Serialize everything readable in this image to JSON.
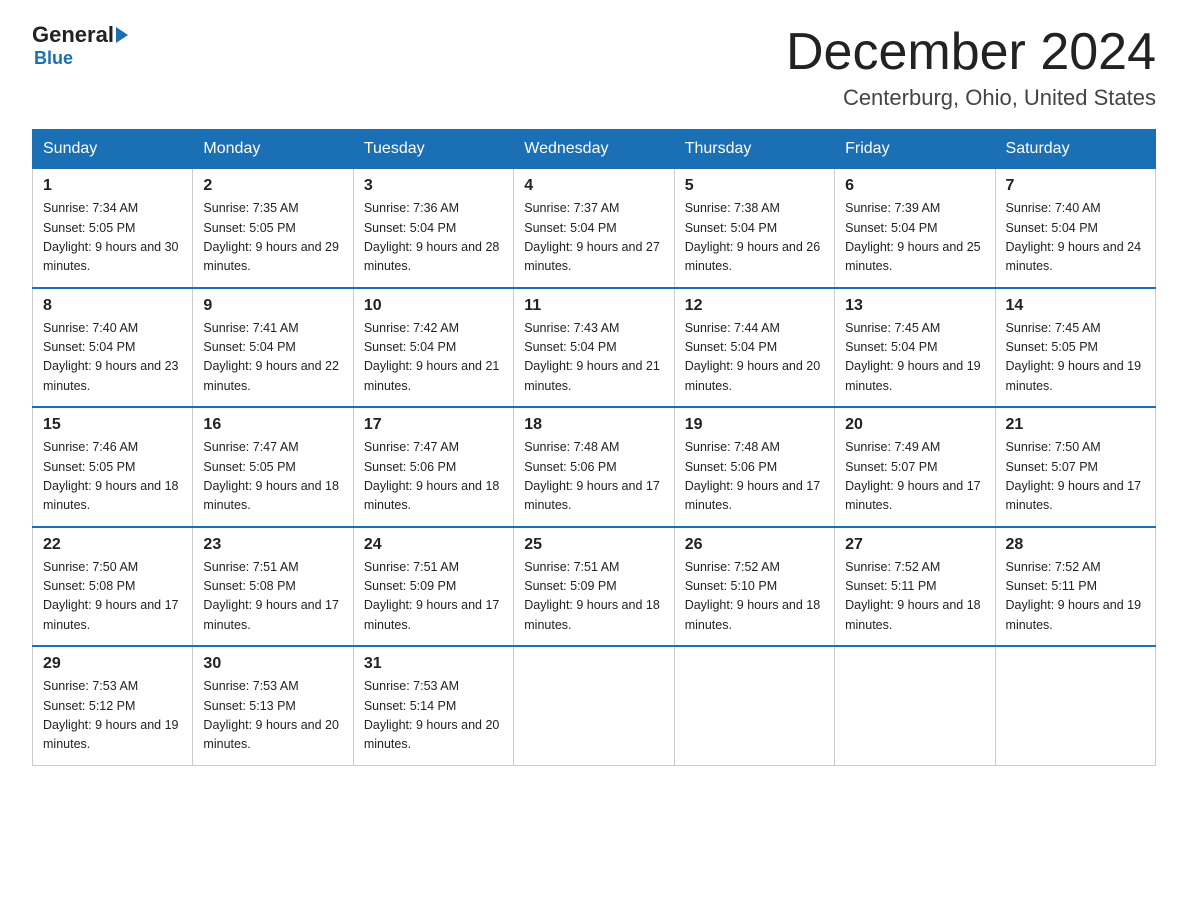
{
  "header": {
    "logo_general": "General",
    "logo_blue": "Blue",
    "month_title": "December 2024",
    "location": "Centerburg, Ohio, United States"
  },
  "days_of_week": [
    "Sunday",
    "Monday",
    "Tuesday",
    "Wednesday",
    "Thursday",
    "Friday",
    "Saturday"
  ],
  "weeks": [
    [
      {
        "num": "1",
        "sunrise": "7:34 AM",
        "sunset": "5:05 PM",
        "daylight": "9 hours and 30 minutes."
      },
      {
        "num": "2",
        "sunrise": "7:35 AM",
        "sunset": "5:05 PM",
        "daylight": "9 hours and 29 minutes."
      },
      {
        "num": "3",
        "sunrise": "7:36 AM",
        "sunset": "5:04 PM",
        "daylight": "9 hours and 28 minutes."
      },
      {
        "num": "4",
        "sunrise": "7:37 AM",
        "sunset": "5:04 PM",
        "daylight": "9 hours and 27 minutes."
      },
      {
        "num": "5",
        "sunrise": "7:38 AM",
        "sunset": "5:04 PM",
        "daylight": "9 hours and 26 minutes."
      },
      {
        "num": "6",
        "sunrise": "7:39 AM",
        "sunset": "5:04 PM",
        "daylight": "9 hours and 25 minutes."
      },
      {
        "num": "7",
        "sunrise": "7:40 AM",
        "sunset": "5:04 PM",
        "daylight": "9 hours and 24 minutes."
      }
    ],
    [
      {
        "num": "8",
        "sunrise": "7:40 AM",
        "sunset": "5:04 PM",
        "daylight": "9 hours and 23 minutes."
      },
      {
        "num": "9",
        "sunrise": "7:41 AM",
        "sunset": "5:04 PM",
        "daylight": "9 hours and 22 minutes."
      },
      {
        "num": "10",
        "sunrise": "7:42 AM",
        "sunset": "5:04 PM",
        "daylight": "9 hours and 21 minutes."
      },
      {
        "num": "11",
        "sunrise": "7:43 AM",
        "sunset": "5:04 PM",
        "daylight": "9 hours and 21 minutes."
      },
      {
        "num": "12",
        "sunrise": "7:44 AM",
        "sunset": "5:04 PM",
        "daylight": "9 hours and 20 minutes."
      },
      {
        "num": "13",
        "sunrise": "7:45 AM",
        "sunset": "5:04 PM",
        "daylight": "9 hours and 19 minutes."
      },
      {
        "num": "14",
        "sunrise": "7:45 AM",
        "sunset": "5:05 PM",
        "daylight": "9 hours and 19 minutes."
      }
    ],
    [
      {
        "num": "15",
        "sunrise": "7:46 AM",
        "sunset": "5:05 PM",
        "daylight": "9 hours and 18 minutes."
      },
      {
        "num": "16",
        "sunrise": "7:47 AM",
        "sunset": "5:05 PM",
        "daylight": "9 hours and 18 minutes."
      },
      {
        "num": "17",
        "sunrise": "7:47 AM",
        "sunset": "5:06 PM",
        "daylight": "9 hours and 18 minutes."
      },
      {
        "num": "18",
        "sunrise": "7:48 AM",
        "sunset": "5:06 PM",
        "daylight": "9 hours and 17 minutes."
      },
      {
        "num": "19",
        "sunrise": "7:48 AM",
        "sunset": "5:06 PM",
        "daylight": "9 hours and 17 minutes."
      },
      {
        "num": "20",
        "sunrise": "7:49 AM",
        "sunset": "5:07 PM",
        "daylight": "9 hours and 17 minutes."
      },
      {
        "num": "21",
        "sunrise": "7:50 AM",
        "sunset": "5:07 PM",
        "daylight": "9 hours and 17 minutes."
      }
    ],
    [
      {
        "num": "22",
        "sunrise": "7:50 AM",
        "sunset": "5:08 PM",
        "daylight": "9 hours and 17 minutes."
      },
      {
        "num": "23",
        "sunrise": "7:51 AM",
        "sunset": "5:08 PM",
        "daylight": "9 hours and 17 minutes."
      },
      {
        "num": "24",
        "sunrise": "7:51 AM",
        "sunset": "5:09 PM",
        "daylight": "9 hours and 17 minutes."
      },
      {
        "num": "25",
        "sunrise": "7:51 AM",
        "sunset": "5:09 PM",
        "daylight": "9 hours and 18 minutes."
      },
      {
        "num": "26",
        "sunrise": "7:52 AM",
        "sunset": "5:10 PM",
        "daylight": "9 hours and 18 minutes."
      },
      {
        "num": "27",
        "sunrise": "7:52 AM",
        "sunset": "5:11 PM",
        "daylight": "9 hours and 18 minutes."
      },
      {
        "num": "28",
        "sunrise": "7:52 AM",
        "sunset": "5:11 PM",
        "daylight": "9 hours and 19 minutes."
      }
    ],
    [
      {
        "num": "29",
        "sunrise": "7:53 AM",
        "sunset": "5:12 PM",
        "daylight": "9 hours and 19 minutes."
      },
      {
        "num": "30",
        "sunrise": "7:53 AM",
        "sunset": "5:13 PM",
        "daylight": "9 hours and 20 minutes."
      },
      {
        "num": "31",
        "sunrise": "7:53 AM",
        "sunset": "5:14 PM",
        "daylight": "9 hours and 20 minutes."
      },
      null,
      null,
      null,
      null
    ]
  ]
}
